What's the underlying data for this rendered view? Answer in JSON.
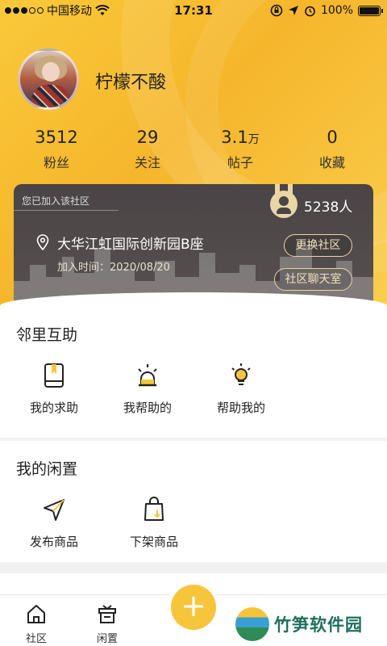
{
  "status_bar": {
    "carrier": "中国移动",
    "time": "17:31",
    "battery": "100%"
  },
  "profile": {
    "username": "柠檬不酸"
  },
  "stats": [
    {
      "value": "3512",
      "unit": "",
      "label": "粉丝"
    },
    {
      "value": "29",
      "unit": "",
      "label": "关注"
    },
    {
      "value": "3.1",
      "unit": "万",
      "label": "帖子"
    },
    {
      "value": "0",
      "unit": "",
      "label": "收藏"
    }
  ],
  "community": {
    "joined_label": "您已加入该社区",
    "members": "5238人",
    "name": "大华江虹国际创新园B座",
    "join_time": "加入时间：2020/08/20",
    "switch_button": "更换社区",
    "chat_button": "社区聊天室"
  },
  "neighbor_help": {
    "title": "邻里互助",
    "items": [
      {
        "label": "我的求助",
        "icon": "book-icon"
      },
      {
        "label": "我帮助的",
        "icon": "alarm-lamp-icon"
      },
      {
        "label": "帮助我的",
        "icon": "lightbulb-icon"
      }
    ]
  },
  "idle": {
    "title": "我的闲置",
    "items": [
      {
        "label": "发布商品",
        "icon": "paper-plane-icon"
      },
      {
        "label": "下架商品",
        "icon": "shopping-bag-down-icon"
      }
    ]
  },
  "tabbar": {
    "tabs": [
      {
        "label": "社区",
        "icon": "home-icon"
      },
      {
        "label": "闲置",
        "icon": "gift-box-icon"
      }
    ],
    "fab": "+"
  },
  "watermark": {
    "text": "竹笋软件园"
  },
  "colors": {
    "accent": "#f7c53b",
    "card": "#4a4446",
    "gold": "#e9d6a4"
  }
}
